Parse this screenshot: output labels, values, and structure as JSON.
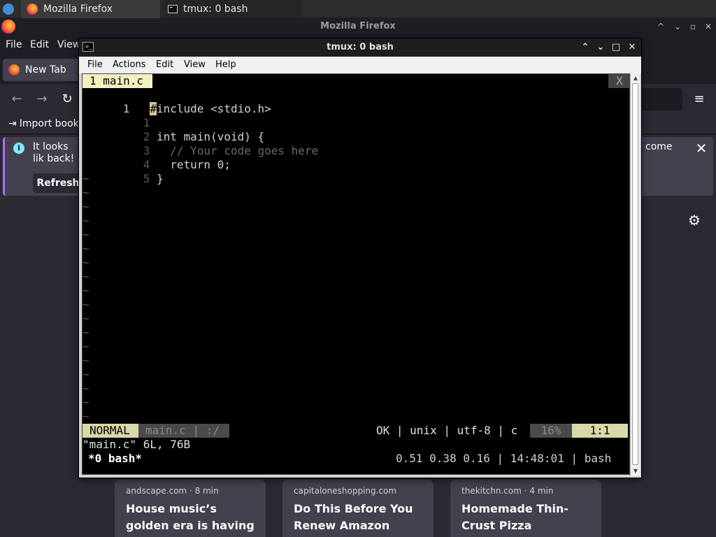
{
  "taskbar": {
    "tasks": [
      {
        "label": "Mozilla Firefox",
        "icon": "firefox-icon"
      },
      {
        "label": "tmux: 0 bash",
        "icon": "terminal-icon"
      }
    ]
  },
  "firefox": {
    "title": "Mozilla Firefox",
    "menu": [
      "File",
      "Edit",
      "View"
    ],
    "tab": {
      "label": "New Tab"
    },
    "bookmarks": {
      "import_label": "Import book"
    },
    "notice": {
      "text_left": "It looks lik back!",
      "text_right": "come",
      "button_label": "Refresh"
    },
    "stories": [
      {
        "source": "andscape.com · 8 min",
        "title": "House music’s golden era is having a"
      },
      {
        "source": "capitaloneshopping.com",
        "title": "Do This Before You Renew Amazon Prime"
      },
      {
        "source": "thekitchn.com · 4 min",
        "title": "Homemade Thin-Crust Pizza"
      }
    ]
  },
  "terminal": {
    "title": "tmux: 0 bash",
    "menu": [
      "File",
      "Actions",
      "Edit",
      "View",
      "Help"
    ],
    "vim": {
      "tab_label": "1 main.c",
      "tab_close": "X",
      "lines": [
        {
          "num": "1",
          "text": "#include <stdio.h>"
        },
        {
          "num": "1",
          "text": ""
        },
        {
          "num": "2",
          "text": "int main(void) {"
        },
        {
          "num": "3",
          "text": "  // Your code goes here"
        },
        {
          "num": "4",
          "text": "  return 0;"
        },
        {
          "num": "5",
          "text": "}"
        }
      ],
      "tilde": "~",
      "status": {
        "mode": "NORMAL",
        "file": "main.c | :/",
        "info": "OK | unix | utf-8 | c",
        "percent": "16%",
        "position": "1:1"
      },
      "message": "\"main.c\" 6L, 76B"
    },
    "tmux": {
      "window": "*0 bash*",
      "status_right": "0.51 0.38 0.16 | 14:48:01 | bash"
    }
  }
}
